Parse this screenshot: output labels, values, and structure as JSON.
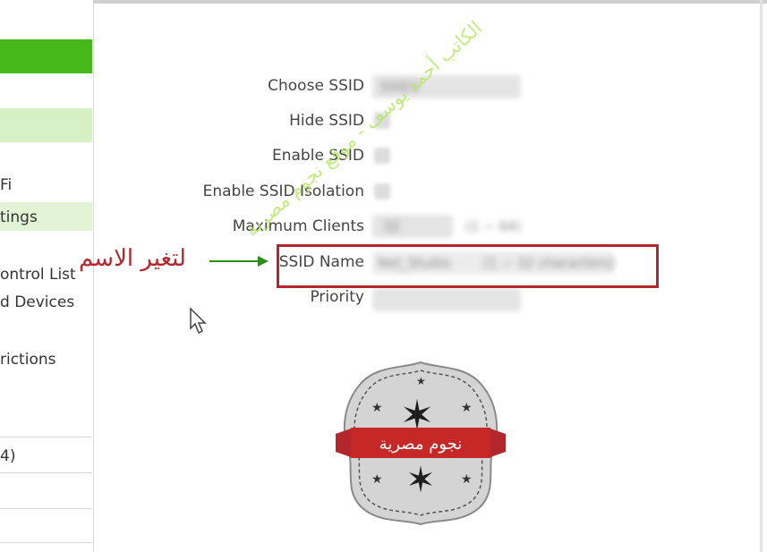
{
  "sidebar": {
    "items": [
      {
        "label": "Fi"
      },
      {
        "label": "tings"
      },
      {
        "label": "ontrol List"
      },
      {
        "label": "d Devices"
      },
      {
        "label": "rictions"
      },
      {
        "label": "4)"
      }
    ]
  },
  "form": {
    "choose_ssid": {
      "label": "Choose SSID",
      "value": "SSID1"
    },
    "hide_ssid": {
      "label": "Hide SSID"
    },
    "enable_ssid": {
      "label": "Enable SSID"
    },
    "ssid_isolation": {
      "label": "Enable SSID Isolation"
    },
    "max_clients": {
      "label": "Maximum Clients",
      "value": "32",
      "range": "(1 ~ 64)"
    },
    "ssid_name": {
      "label": "SSID Name",
      "value": "Net_Studio",
      "hint": "(1 ~ 32 characters)"
    },
    "priority": {
      "label": "Priority",
      "value": ""
    }
  },
  "annotation": {
    "text": "لتغير الاسم"
  },
  "watermark": {
    "text": "الكاتب أحمد يوسف - موقع نجوم مصرية"
  },
  "logo": {
    "banner": "نجوم مصرية"
  },
  "colors": {
    "accent_green": "#47b81a",
    "light_green": "#d7f0c6",
    "highlight_red": "#b3262b",
    "arrow_green": "#2e8b1e"
  }
}
